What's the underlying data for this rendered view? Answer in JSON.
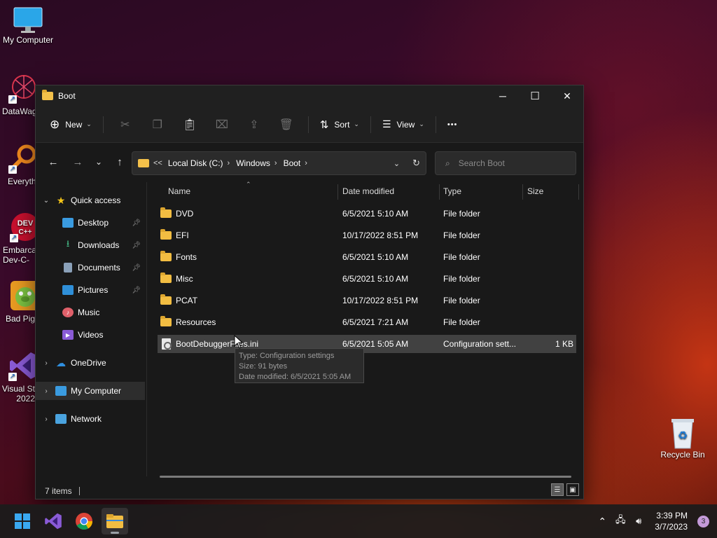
{
  "desktop": {
    "icons": [
      {
        "label": "My Computer"
      },
      {
        "label": "DataWag"
      },
      {
        "label": "Everyth"
      },
      {
        "label": "Embarca\nDev-C-"
      },
      {
        "label": "Bad Pig"
      },
      {
        "label": "Visual St\n2022"
      },
      {
        "label": "Recycle Bin"
      }
    ]
  },
  "window": {
    "title": "Boot",
    "controls": {
      "minimize": "─",
      "maximize": "☐",
      "close": "✕"
    }
  },
  "toolbar": {
    "new_label": "New",
    "sort_label": "Sort",
    "view_label": "View",
    "more_label": "•••"
  },
  "address": {
    "overflow": "<<",
    "crumbs": [
      "Local Disk (C:)",
      "Windows",
      "Boot"
    ]
  },
  "search": {
    "placeholder": "Search Boot"
  },
  "sidebar": {
    "quick_access": "Quick access",
    "items": [
      {
        "label": "Desktop"
      },
      {
        "label": "Downloads"
      },
      {
        "label": "Documents"
      },
      {
        "label": "Pictures"
      },
      {
        "label": "Music"
      },
      {
        "label": "Videos"
      }
    ],
    "onedrive": "OneDrive",
    "my_computer": "My Computer",
    "network": "Network"
  },
  "columns": {
    "name": "Name",
    "date": "Date modified",
    "type": "Type",
    "size": "Size"
  },
  "files": [
    {
      "name": "DVD",
      "date": "6/5/2021 5:10 AM",
      "type": "File folder",
      "size": ""
    },
    {
      "name": "EFI",
      "date": "10/17/2022 8:51 PM",
      "type": "File folder",
      "size": ""
    },
    {
      "name": "Fonts",
      "date": "6/5/2021 5:10 AM",
      "type": "File folder",
      "size": ""
    },
    {
      "name": "Misc",
      "date": "6/5/2021 5:10 AM",
      "type": "File folder",
      "size": ""
    },
    {
      "name": "PCAT",
      "date": "10/17/2022 8:51 PM",
      "type": "File folder",
      "size": ""
    },
    {
      "name": "Resources",
      "date": "6/5/2021 7:21 AM",
      "type": "File folder",
      "size": ""
    },
    {
      "name": "BootDebuggerFiles.ini",
      "date": "6/5/2021 5:05 AM",
      "type": "Configuration sett...",
      "size": "1 KB"
    }
  ],
  "tooltip": {
    "type": "Type: Configuration settings",
    "size": "Size: 91 bytes",
    "date": "Date modified: 6/5/2021 5:05 AM"
  },
  "status": {
    "count": "7 items"
  },
  "taskbar": {
    "time": "3:39 PM",
    "date": "3/7/2023",
    "badge": "3"
  },
  "colors": {
    "accent_folder": "#f2bd42",
    "window_bg": "#191919",
    "selection": "#414141"
  }
}
